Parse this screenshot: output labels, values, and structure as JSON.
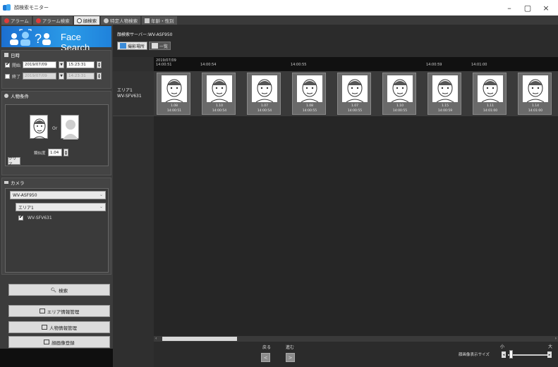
{
  "window": {
    "title": "顔検索モニター",
    "controls": [
      "–",
      "▢",
      "×"
    ]
  },
  "tabs": [
    {
      "label": "アラーム",
      "icon": "alarm-icon",
      "color": "#e03b3b",
      "active": false
    },
    {
      "label": "アラーム検索",
      "icon": "alarm-search-icon",
      "color": "#e03b3b",
      "active": false
    },
    {
      "label": "顔検索",
      "icon": "face-search-icon",
      "color": "#444444",
      "active": true
    },
    {
      "label": "特定人物検索",
      "icon": "specific-person-icon",
      "color": "#cccccc",
      "active": false
    },
    {
      "label": "年齢・性別",
      "icon": "bar-chart-icon",
      "color": "#cccccc",
      "active": false
    }
  ],
  "left": {
    "banner_title": "Face Search",
    "datetime": {
      "header": "日時",
      "start_label": "開始",
      "start_date": "2019/07/09",
      "start_time": "15:23:31",
      "end_label": "終了",
      "end_date": "2019/07/09",
      "end_time": "14:23:31"
    },
    "person": {
      "header": "人物条件",
      "or_label": "Or",
      "similarity_label": "類似度",
      "similarity_value": "1.04",
      "clear_label": "クリア"
    },
    "camera": {
      "header": "カメラ",
      "server": "WV-ASF950",
      "area": "エリア1",
      "camera_item": "WV-SFV631"
    },
    "buttons": {
      "search": "検索",
      "area_info": "エリア情報管理",
      "person_info": "人物情報管理",
      "register": "顔画像登録"
    }
  },
  "right": {
    "server_label": "顔検索サーバー:WV-ASF950",
    "view_tabs": [
      {
        "label": "撮影場所",
        "active": true
      },
      {
        "label": "一覧",
        "active": false
      }
    ],
    "time_header": {
      "first_date": "2019/07/09",
      "first_time": "14:00:51",
      "labels": [
        "14:00:54",
        "14:00:55",
        "14:00:59",
        "14:01:00"
      ]
    },
    "row_label_line1": "エリア1",
    "row_label_line2": "WV-SFV631",
    "faces": [
      {
        "score": "1.08",
        "time": "14:00:51"
      },
      {
        "score": "1.10",
        "time": "14:00:54"
      },
      {
        "score": "1.07",
        "time": "14:00:54"
      },
      {
        "score": "1.08",
        "time": "14:00:55"
      },
      {
        "score": "1.07",
        "time": "14:00:55"
      },
      {
        "score": "1.10",
        "time": "14:00:55"
      },
      {
        "score": "1.15",
        "time": "14:00:59"
      },
      {
        "score": "1.11",
        "time": "14:01:00"
      },
      {
        "score": "1.14",
        "time": "14:01:00"
      }
    ],
    "nav": {
      "back_label": "戻る",
      "forward_label": "進む",
      "back_arrow": "<",
      "forward_arrow": ">"
    },
    "size": {
      "label": "顔画像表示サイズ",
      "small": "小",
      "large": "大"
    }
  }
}
